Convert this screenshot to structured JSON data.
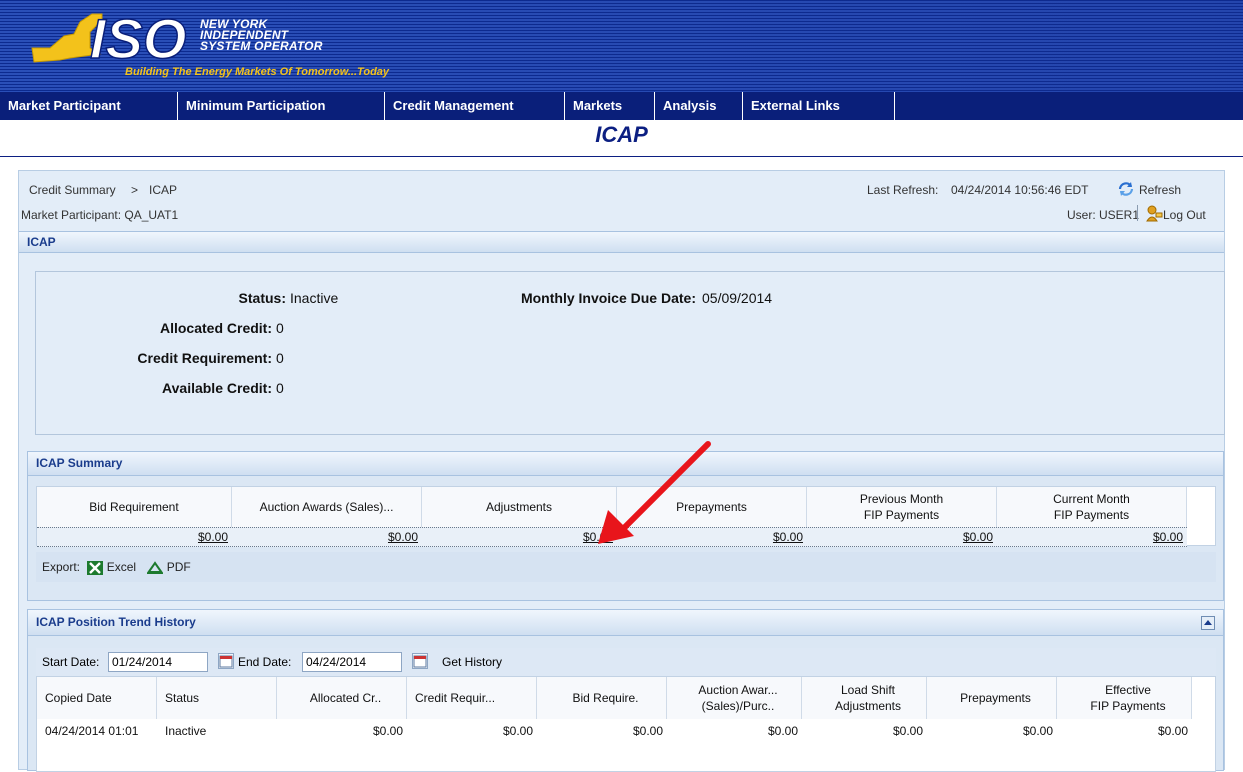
{
  "banner": {
    "logo_iso": "ISO",
    "logo_lines": [
      "NEW YORK",
      "INDEPENDENT",
      "SYSTEM OPERATOR"
    ],
    "tagline": "Building The Energy Markets Of Tomorrow...Today"
  },
  "nav": {
    "items": [
      {
        "label": "Market Participant"
      },
      {
        "label": "Minimum Participation"
      },
      {
        "label": "Credit Management"
      },
      {
        "label": "Markets"
      },
      {
        "label": "Analysis"
      },
      {
        "label": "External Links"
      }
    ]
  },
  "page_title": "ICAP",
  "header": {
    "breadcrumb_root": "Credit Summary",
    "breadcrumb_sep": ">",
    "breadcrumb_current": "ICAP",
    "last_refresh_label": "Last Refresh:",
    "last_refresh_value": "04/24/2014 10:56:46 EDT",
    "refresh_label": "Refresh",
    "market_participant": "Market Participant: QA_UAT1",
    "user": "User: USER1",
    "logout_label": "Log Out"
  },
  "icap": {
    "section_title": "ICAP",
    "status_label": "Status:",
    "status_value": "Inactive",
    "allocated_label": "Allocated Credit:",
    "allocated_value": "0",
    "requirement_label": "Credit Requirement:",
    "requirement_value": "0",
    "available_label": "Available Credit:",
    "available_value": "0",
    "due_label": "Monthly Invoice Due Date:",
    "due_value": "05/09/2014"
  },
  "summary": {
    "title": "ICAP Summary",
    "columns": [
      {
        "line1": "Bid Requirement",
        "line2": ""
      },
      {
        "line1": "Auction Awards (Sales)...",
        "line2": ""
      },
      {
        "line1": "Adjustments",
        "line2": ""
      },
      {
        "line1": "Prepayments",
        "line2": ""
      },
      {
        "line1": "Previous Month",
        "line2": "FIP Payments"
      },
      {
        "line1": "Current Month",
        "line2": "FIP Payments"
      }
    ],
    "values": [
      "$0.00",
      "$0.00",
      "$0.00",
      "$0.00",
      "$0.00",
      "$0.00"
    ],
    "export_label": "Export:",
    "excel_label": "Excel",
    "pdf_label": "PDF"
  },
  "trend": {
    "title": "ICAP Position Trend History",
    "start_label": "Start Date:",
    "start_value": "01/24/2014",
    "end_label": "End Date:",
    "end_value": "04/24/2014",
    "get_history_label": "Get History",
    "columns": [
      {
        "line1": "Copied Date",
        "line2": ""
      },
      {
        "line1": "Status",
        "line2": ""
      },
      {
        "line1": "Allocated Cr..",
        "line2": ""
      },
      {
        "line1": "Credit Requir...",
        "line2": ""
      },
      {
        "line1": "Bid Require.",
        "line2": ""
      },
      {
        "line1": "Auction Awar...",
        "line2": "(Sales)/Purc.."
      },
      {
        "line1": "Load Shift",
        "line2": "Adjustments"
      },
      {
        "line1": "Prepayments",
        "line2": ""
      },
      {
        "line1": "Effective",
        "line2": "FIP Payments"
      }
    ],
    "row": [
      "04/24/2014 01:01",
      "Inactive",
      "$0.00",
      "$0.00",
      "$0.00",
      "$0.00",
      "$0.00",
      "$0.00",
      "$0.00"
    ]
  },
  "colors": {
    "nav_bg": "#0a1f7a",
    "title_blue": "#0c1f82",
    "panel_bg": "#e3edf8",
    "section_text": "#1a3c8c",
    "arrow_red": "#e8151b",
    "logo_yellow": "#f3c21b"
  }
}
